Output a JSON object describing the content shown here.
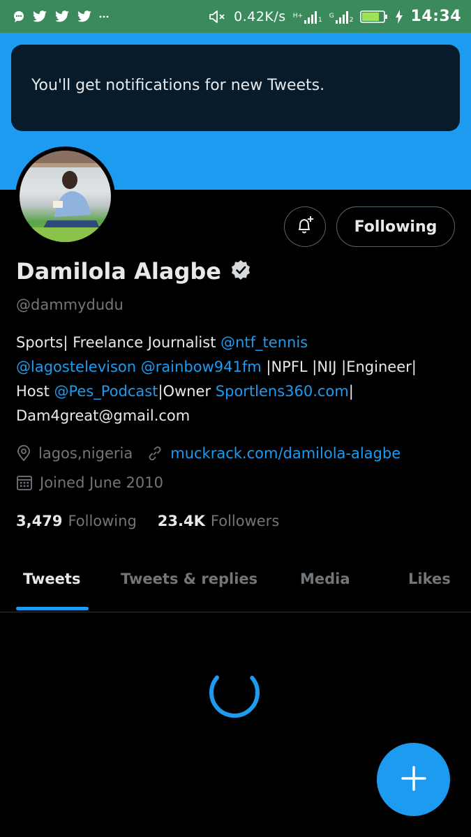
{
  "status_bar": {
    "net_speed": "0.42K/s",
    "sim1_type": "H+",
    "sim1_num": "1",
    "sim2_type": "G",
    "sim2_num": "2",
    "battery_level": 0.8,
    "time": "14:34"
  },
  "toast": {
    "message": "You'll get notifications for new Tweets."
  },
  "actions": {
    "follow_label": "Following"
  },
  "profile": {
    "name": "Damilola Alagbe",
    "handle": "@dammydudu",
    "bio": {
      "t1": "Sports| Freelance Journalist ",
      "m1": "@ntf_tennis",
      "m2": "@lagostelevison",
      "t2": " ",
      "m3": "@rainbow941fm",
      "t3": " |NPFL |NIJ |Engineer|",
      "t4": "Host ",
      "m4": "@Pes_Podcast",
      "t5": "|Owner ",
      "l1": "Sportlens360.com",
      "t6": "|",
      "email": "Dam4great@gmail.com"
    },
    "location": "lagos,nigeria",
    "website": "muckrack.com/damilola-alagbe",
    "joined": "Joined June 2010",
    "following_count": "3,479",
    "following_label": "Following",
    "followers_count": "23.4K",
    "followers_label": "Followers"
  },
  "tabs": [
    "Tweets",
    "Tweets & replies",
    "Media",
    "Likes"
  ],
  "colors": {
    "accent": "#1d9bf0",
    "status_bar": "#3a8a5c",
    "toast_bg": "#071b2a"
  }
}
